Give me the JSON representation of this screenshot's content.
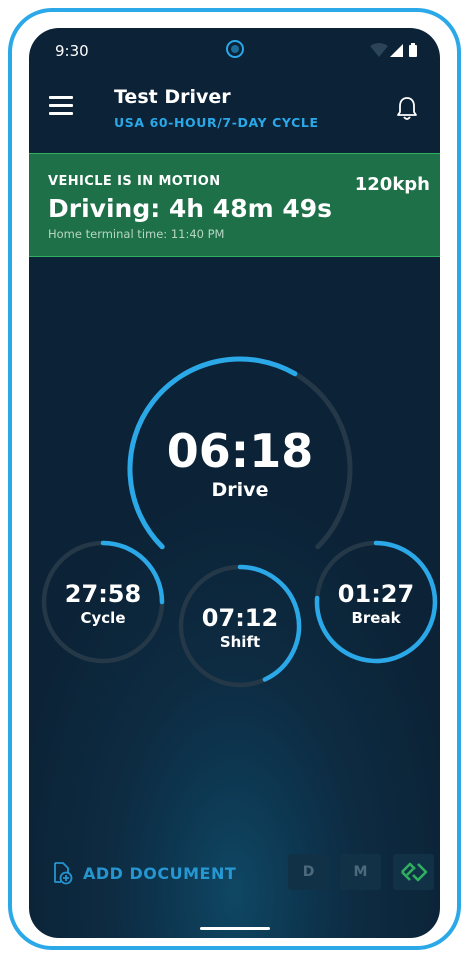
{
  "status_bar": {
    "time": "9:30"
  },
  "header": {
    "driver_name": "Test Driver",
    "cycle": "USA 60-HOUR/7-DAY CYCLE"
  },
  "motion_banner": {
    "title": "VEHICLE IS IN MOTION",
    "speed": "120kph",
    "driving_time": "Driving: 4h 48m 49s",
    "home_terminal_time": "Home terminal time: 11:40 PM",
    "color": "#1e7049"
  },
  "gauges": {
    "drive": {
      "value": "06:18",
      "label": "Drive"
    },
    "cycle": {
      "value": "27:58",
      "label": "Cycle"
    },
    "shift": {
      "value": "07:12",
      "label": "Shift"
    },
    "break": {
      "value": "01:27",
      "label": "Break"
    }
  },
  "bottom_bar": {
    "add_document": "ADD DOCUMENT",
    "mode_buttons": [
      "D",
      "M"
    ]
  },
  "colors": {
    "accent": "#2aa8e8",
    "track": "#243848",
    "background": "#0c2236"
  }
}
